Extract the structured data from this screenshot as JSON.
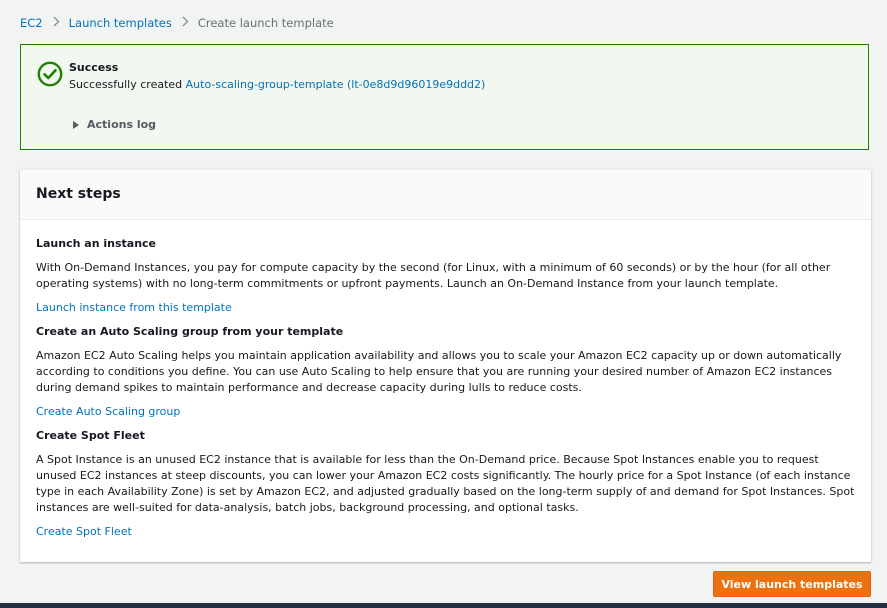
{
  "breadcrumb": {
    "items": [
      "EC2",
      "Launch templates"
    ],
    "current": "Create launch template"
  },
  "flash": {
    "title": "Success",
    "message_prefix": "Successfully created ",
    "template_link": "Auto-scaling-group-template (lt-0e8d9d96019e9ddd2)",
    "actions_log": "Actions log"
  },
  "panel": {
    "title": "Next steps",
    "sections": [
      {
        "title": "Launch an instance",
        "text": "With On-Demand Instances, you pay for compute capacity by the second (for Linux, with a minimum of 60 seconds) or by the hour (for all other operating systems) with no long-term commitments or upfront payments. Launch an On-Demand Instance from your launch template.",
        "link": "Launch instance from this template"
      },
      {
        "title": "Create an Auto Scaling group from your template",
        "text": "Amazon EC2 Auto Scaling helps you maintain application availability and allows you to scale your Amazon EC2 capacity up or down automatically according to conditions you define. You can use Auto Scaling to help ensure that you are running your desired number of Amazon EC2 instances during demand spikes to maintain performance and decrease capacity during lulls to reduce costs.",
        "link": "Create Auto Scaling group"
      },
      {
        "title": "Create Spot Fleet",
        "text": "A Spot Instance is an unused EC2 instance that is available for less than the On-Demand price. Because Spot Instances enable you to request unused EC2 instances at steep discounts, you can lower your Amazon EC2 costs significantly. The hourly price for a Spot Instance (of each instance type in each Availability Zone) is set by Amazon EC2, and adjusted gradually based on the long-term supply of and demand for Spot Instances. Spot instances are well-suited for data-analysis, batch jobs, background processing, and optional tasks.",
        "link": "Create Spot Fleet"
      }
    ]
  },
  "footer": {
    "button_label": "View launch templates"
  },
  "colors": {
    "success": "#1d8102",
    "link": "#0073bb",
    "primary_button": "#ec7211"
  },
  "icons": {
    "success": "check-circle-icon",
    "separator": "chevron-right-icon",
    "expand": "caret-right-icon"
  }
}
